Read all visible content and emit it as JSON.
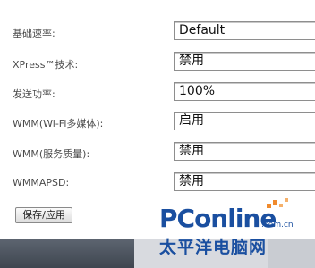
{
  "settings": [
    {
      "label": "基础速率:",
      "value": "Default"
    },
    {
      "label": "XPress™技术:",
      "value": "禁用"
    },
    {
      "label": "发送功率:",
      "value": "100%"
    },
    {
      "label": "WMM(Wi-Fi多媒体):",
      "value": "启用"
    },
    {
      "label": "WMM(服务质量):",
      "value": "禁用"
    },
    {
      "label": "WMMAPSD:",
      "value": "禁用"
    }
  ],
  "save_button": "保存/应用",
  "watermark": {
    "brand": "PConline",
    "domain": ".com.cn",
    "cn_name": "太平洋电脑网"
  },
  "colors": {
    "watermark": "#1a4fa0",
    "watermark_accent": "#f08a2c"
  }
}
